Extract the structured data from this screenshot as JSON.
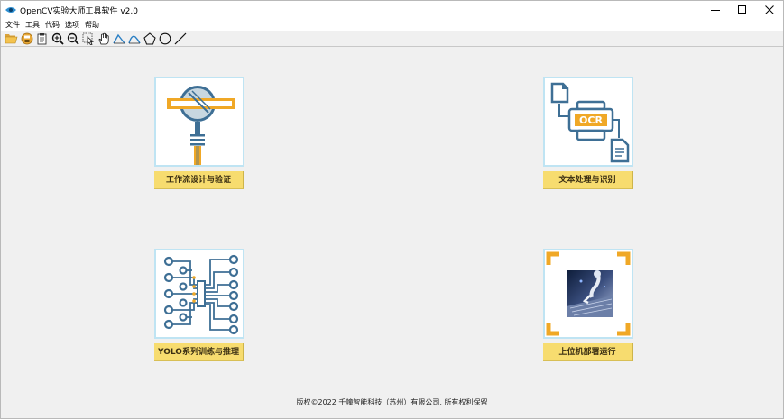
{
  "window": {
    "title": "OpenCV实验大师工具软件 v2.0"
  },
  "menu": {
    "items": [
      "文件",
      "工具",
      "代码",
      "选项",
      "帮助"
    ]
  },
  "toolbar": {
    "icons": [
      "open-folder-icon",
      "save-icon",
      "clipboard-icon",
      "zoom-in-icon",
      "zoom-out-icon",
      "select-icon",
      "hand-icon",
      "draw-line-tool-icon",
      "draw-curve-tool-icon",
      "polygon-icon",
      "circle-icon",
      "line-icon"
    ]
  },
  "cards": [
    {
      "label": "工作流设计与验证",
      "icon": "magnifier-icon"
    },
    {
      "label": "文本处理与识别",
      "icon": "ocr-icon",
      "ocr_text": "OCR"
    },
    {
      "label": "YOLO系列训练与推理",
      "icon": "neural-network-icon"
    },
    {
      "label": "上位机部署运行",
      "icon": "robot-photo-icon"
    }
  ],
  "footer": {
    "text": "版权©2022 千幢智能科技（苏州）有限公司, 所有权利保留"
  },
  "colors": {
    "card_label_bg": "#f7dc6f",
    "card_border": "#bfe4f3",
    "icon_blue": "#3e6f95",
    "icon_orange": "#f0a826"
  }
}
